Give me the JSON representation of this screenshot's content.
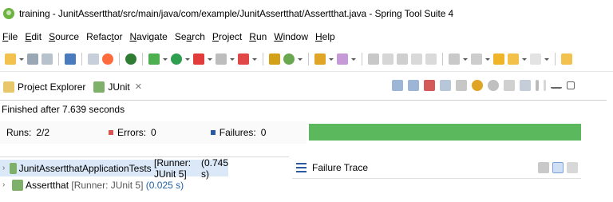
{
  "window": {
    "title": "training - JunitAssertthat/src/main/java/com/example/JunitAssertthat/Assertthat.java - Spring Tool Suite 4"
  },
  "menu": [
    {
      "label_underlined": "F",
      "label_rest": "ile"
    },
    {
      "label_underlined": "E",
      "label_rest": "dit"
    },
    {
      "label_underlined": "S",
      "label_rest": "ource"
    },
    {
      "label_prefix": "Refac",
      "label_underlined": "t",
      "label_rest": "or"
    },
    {
      "label_underlined": "N",
      "label_rest": "avigate"
    },
    {
      "label_prefix": "Se",
      "label_underlined": "a",
      "label_rest": "rch"
    },
    {
      "label_underlined": "P",
      "label_rest": "roject"
    },
    {
      "label_underlined": "R",
      "label_rest": "un"
    },
    {
      "label_underlined": "W",
      "label_rest": "indow"
    },
    {
      "label_underlined": "H",
      "label_rest": "elp"
    }
  ],
  "tabs": {
    "project_explorer": "Project Explorer",
    "junit": "JUnit",
    "junit_close": "✕"
  },
  "status": {
    "finished": "Finished after 7.639 seconds"
  },
  "counters": {
    "runs_label": "Runs:",
    "runs_value": "2/2",
    "errors_label": "Errors:",
    "errors_value": "0",
    "failures_label": "Failures:",
    "failures_value": "0"
  },
  "progress": {
    "fraction": 1.0,
    "color": "#5cb85c"
  },
  "tree": [
    {
      "name": "JunitAssertthatApplicationTests",
      "meta": "[Runner: JUnit 5]",
      "time": "(0.745 s)",
      "selected": true
    },
    {
      "name": "Assertthat",
      "meta": "[Runner: JUnit 5]",
      "time": "(0.025 s)",
      "selected": false
    }
  ],
  "trace": {
    "title": "Failure Trace"
  },
  "colors": {
    "accent_green": "#6db33f",
    "error_red": "#d9534f",
    "failure_blue": "#2c5aa0",
    "selection": "#dbe8f7"
  }
}
